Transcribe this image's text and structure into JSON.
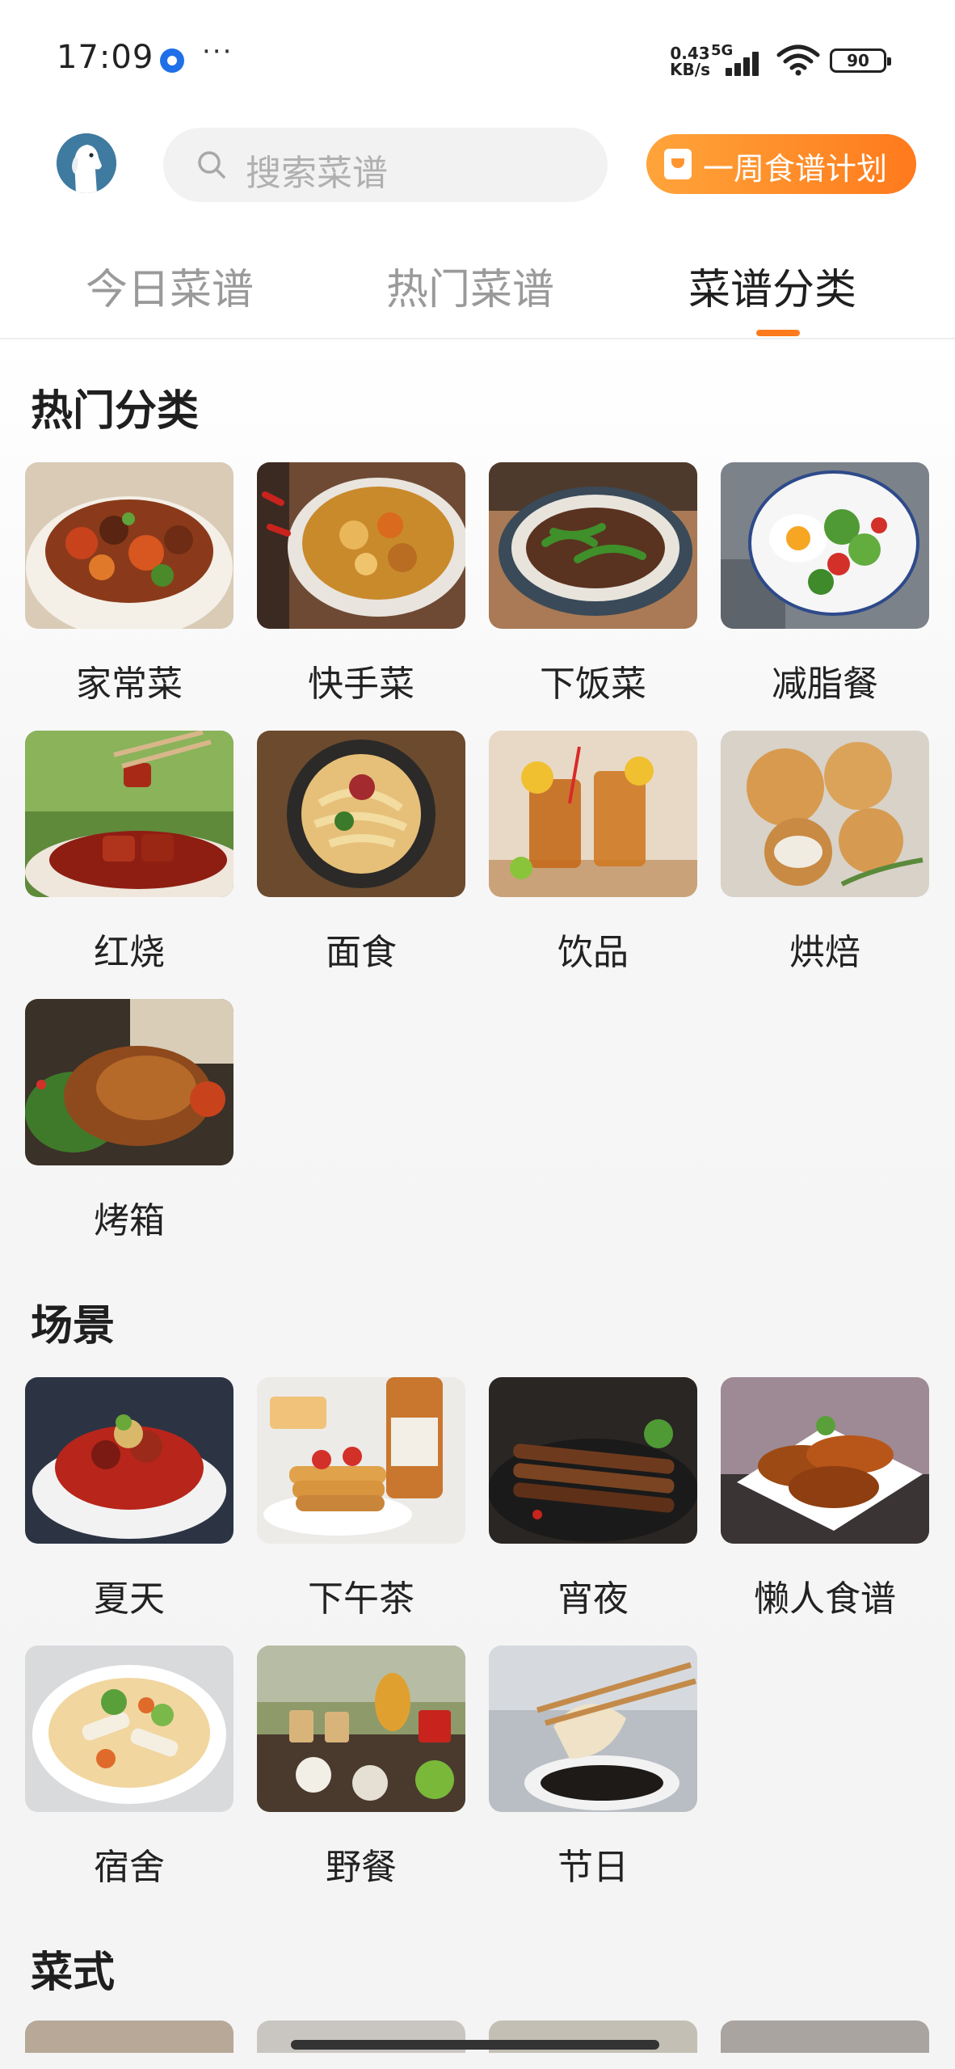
{
  "status_bar": {
    "time": "17:09",
    "more": "···",
    "net_speed": "0.43 KB/s",
    "net_type": "5G",
    "battery": "90"
  },
  "header": {
    "search_placeholder": "搜索菜谱",
    "plan_button": "一周食谱计划"
  },
  "tabs": [
    {
      "label": "今日菜谱",
      "active": false
    },
    {
      "label": "热门菜谱",
      "active": false
    },
    {
      "label": "菜谱分类",
      "active": true
    }
  ],
  "sections": [
    {
      "title": "热门分类",
      "items": [
        {
          "label": "家常菜"
        },
        {
          "label": "快手菜"
        },
        {
          "label": "下饭菜"
        },
        {
          "label": "减脂餐"
        },
        {
          "label": "红烧"
        },
        {
          "label": "面食"
        },
        {
          "label": "饮品"
        },
        {
          "label": "烘焙"
        },
        {
          "label": "烤箱"
        }
      ]
    },
    {
      "title": "场景",
      "items": [
        {
          "label": "夏天"
        },
        {
          "label": "下午茶"
        },
        {
          "label": "宵夜"
        },
        {
          "label": "懒人食谱"
        },
        {
          "label": "宿舍"
        },
        {
          "label": "野餐"
        },
        {
          "label": "节日"
        }
      ]
    },
    {
      "title": "菜式",
      "items": []
    }
  ],
  "colors": {
    "accent": "#ff7a1c",
    "plan_gradient_start": "#ffa43a",
    "plan_gradient_end": "#ff7a1c"
  }
}
